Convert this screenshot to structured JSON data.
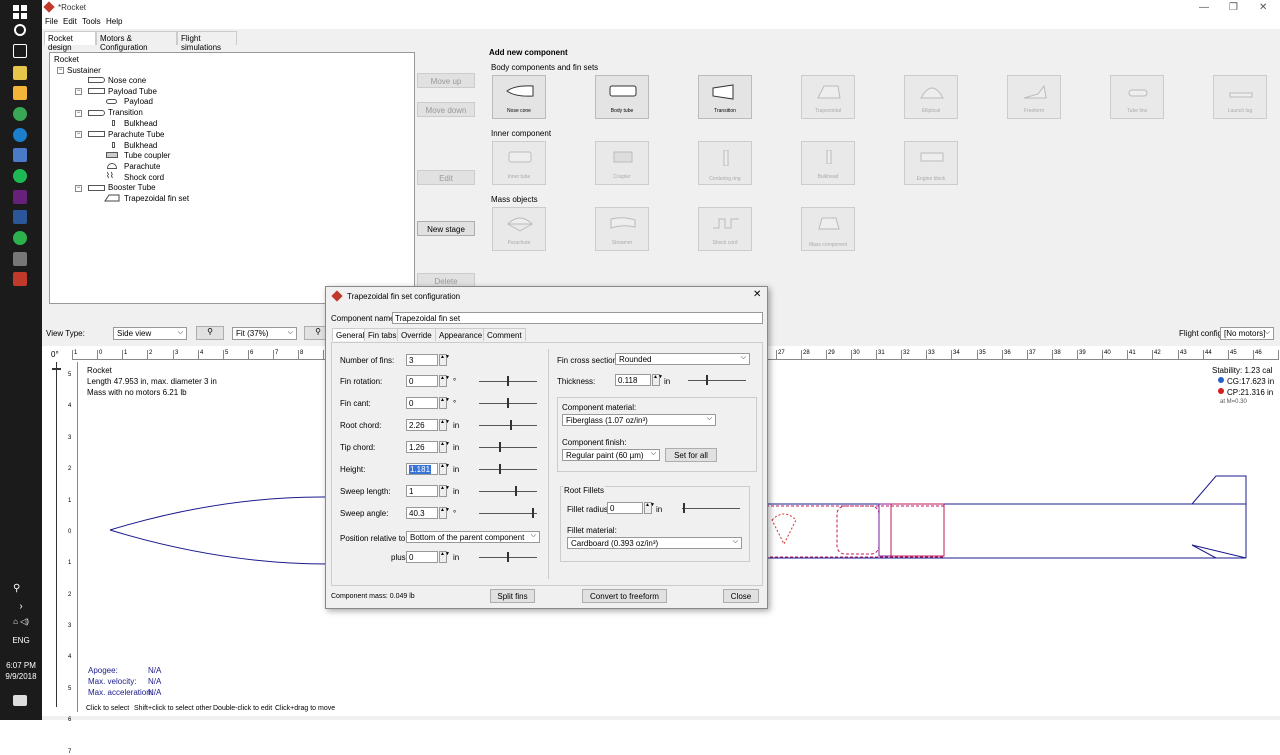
{
  "taskbar": {
    "clock_time": "6:07 PM",
    "clock_date": "9/9/2018",
    "lang": "ENG"
  },
  "window": {
    "title": "*Rocket"
  },
  "menu": [
    "File",
    "Edit",
    "Tools",
    "Help"
  ],
  "tabs": [
    "Rocket design",
    "Motors & Configuration",
    "Flight simulations"
  ],
  "tree": [
    {
      "label": "Rocket"
    },
    {
      "label": "Sustainer"
    },
    {
      "label": "Nose cone"
    },
    {
      "label": "Payload Tube"
    },
    {
      "label": "Payload"
    },
    {
      "label": "Transition"
    },
    {
      "label": "Bulkhead"
    },
    {
      "label": "Parachute Tube"
    },
    {
      "label": "Bulkhead"
    },
    {
      "label": "Tube coupler"
    },
    {
      "label": "Parachute"
    },
    {
      "label": "Shock cord"
    },
    {
      "label": "Booster Tube"
    },
    {
      "label": "Trapezoidal fin set"
    }
  ],
  "side_buttons": {
    "move_up": "Move up",
    "move_down": "Move down",
    "edit": "Edit",
    "new_stage": "New stage",
    "delete": "Delete"
  },
  "add_panel": {
    "title": "Add new component",
    "body_header": "Body components and fin sets",
    "body": [
      "Nose cone",
      "Body tube",
      "Transition",
      "Trapezoidal",
      "Elliptical",
      "Freeform",
      "Tube fins",
      "Launch lug"
    ],
    "inner_header": "Inner component",
    "inner": [
      "Inner tube",
      "Coupler",
      "Centering ring",
      "Bulkhead",
      "Engine block"
    ],
    "mass_header": "Mass objects",
    "mass": [
      "Parachute",
      "Streamer",
      "Shock cord",
      "Mass component"
    ]
  },
  "viewbar": {
    "view_type_label": "View Type:",
    "view_type": "Side view",
    "zoom": "Fit (37%)",
    "stab_btn": "St",
    "flight_config_label": "Flight configuration:",
    "flight_config": "[No motors]"
  },
  "canvas": {
    "rotation": "0°",
    "ruler_top": [
      "1",
      "0",
      "1",
      "2",
      "3",
      "4",
      "5",
      "6",
      "7",
      "8",
      "9",
      "10",
      "11",
      "12",
      "13",
      "14",
      "15",
      "16",
      "17",
      "18",
      "19",
      "20",
      "21",
      "22",
      "23",
      "24",
      "25",
      "26",
      "27",
      "28",
      "29",
      "30",
      "31",
      "32",
      "33",
      "34",
      "35",
      "36",
      "37",
      "38",
      "39",
      "40",
      "41",
      "42",
      "43",
      "44",
      "45",
      "46",
      "47",
      "48"
    ],
    "ruler_left": [
      "5",
      "4",
      "3",
      "2",
      "1",
      "0",
      "1",
      "2",
      "3",
      "4",
      "5",
      "6",
      "7"
    ],
    "rocket_name": "Rocket",
    "length_info": "Length 47.953 in, max. diameter 3 in",
    "mass_info": "Mass with no motors 6.21 lb",
    "stability": "Stability:  1.23 cal",
    "cg": "CG:17.623 in",
    "cp": "CP:21.316 in",
    "mach": "at M=0.30",
    "apogee_label": "Apogee:",
    "apogee": "N/A",
    "velocity_label": "Max. velocity:",
    "velocity": "N/A",
    "accel_label": "Max. acceleration:",
    "accel": "N/A"
  },
  "status_hints": [
    "Click to select",
    "Shift+click to select other",
    "Double-click to edit",
    "Click+drag to move"
  ],
  "dialog": {
    "title": "Trapezoidal fin set configuration",
    "component_name_label": "Component name:",
    "component_name": "Trapezoidal fin set",
    "tabs": [
      "General",
      "Fin tabs",
      "Override",
      "Appearance",
      "Comment"
    ],
    "fields": [
      {
        "label": "Number of fins:",
        "value": "3",
        "unit": "",
        "slider": null
      },
      {
        "label": "Fin rotation:",
        "value": "0",
        "unit": "°",
        "slider": 0.5
      },
      {
        "label": "Fin cant:",
        "value": "0",
        "unit": "°",
        "slider": 0.5
      },
      {
        "label": "Root chord:",
        "value": "2.26",
        "unit": "in",
        "slider": 0.55
      },
      {
        "label": "Tip chord:",
        "value": "1.26",
        "unit": "in",
        "slider": 0.35
      },
      {
        "label": "Height:",
        "value": "1.181",
        "unit": "in",
        "slider": 0.35
      },
      {
        "label": "Sweep length:",
        "value": "1",
        "unit": "in",
        "slider": 0.65
      },
      {
        "label": "Sweep angle:",
        "value": "40.3",
        "unit": "°",
        "slider": 0.95
      }
    ],
    "position_label": "Position relative to:",
    "position_value": "Bottom of the parent component",
    "plus_label": "plus",
    "plus_value": "0",
    "plus_unit": "in",
    "cross_section_label": "Fin cross section:",
    "cross_section": "Rounded",
    "thickness_label": "Thickness:",
    "thickness": "0.118",
    "thickness_unit": "in",
    "material_label": "Component material:",
    "material": "Fiberglass (1.07 oz/in³)",
    "finish_label": "Component finish:",
    "finish": "Regular paint (60 µm)",
    "set_for_all": "Set for all",
    "root_fillets": "Root Fillets",
    "fillet_radius_label": "Fillet radius:",
    "fillet_radius": "0",
    "fillet_radius_unit": "in",
    "fillet_material_label": "Fillet material:",
    "fillet_material": "Cardboard (0.393 oz/in³)",
    "mass": "Component mass: 0.049 lb",
    "split_fins": "Split fins",
    "convert": "Convert to freeform",
    "close": "Close"
  }
}
